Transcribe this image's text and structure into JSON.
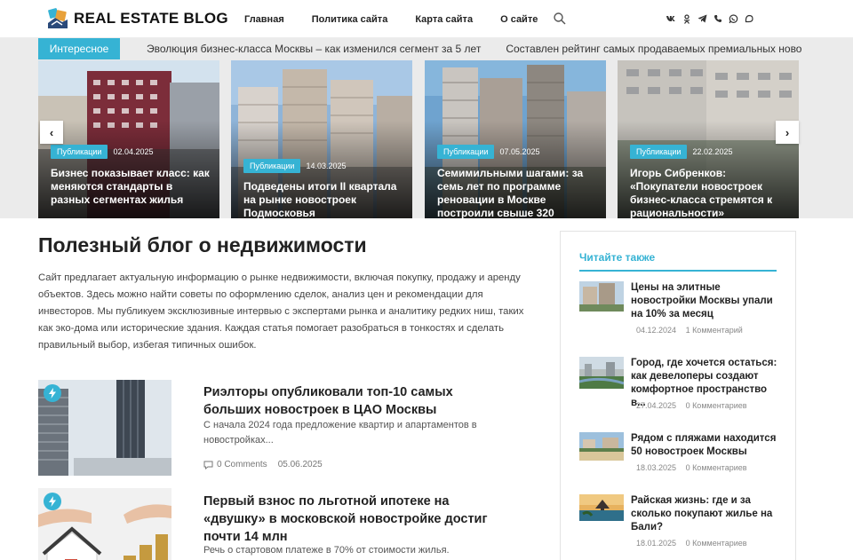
{
  "header": {
    "logo_text": "REAL ESTATE BLOG",
    "nav": [
      "Главная",
      "Политика сайта",
      "Карта сайта",
      "О сайте"
    ],
    "socials": [
      "vk-icon",
      "odnoklassniki-icon",
      "telegram-icon",
      "viber-icon",
      "whatsapp-icon",
      "max-icon"
    ]
  },
  "ticker": {
    "label": "Интересное",
    "items": [
      "Эволюция бизнес-класса Москвы – как изменился сегмент за 5 лет",
      "Составлен рейтинг самых продаваемых премиальных новостроек"
    ]
  },
  "slider": {
    "prev_label": "‹",
    "next_label": "›",
    "cards": [
      {
        "badge": "Публикации",
        "date": "02.04.2025",
        "title": "Бизнес показывает класс: как меняются стандарты в разных сегментах жилья"
      },
      {
        "badge": "Публикации",
        "date": "14.03.2025",
        "title": "Подведены итоги II квартала на рынке новостроек Подмосковья"
      },
      {
        "badge": "Публикации",
        "date": "07.05.2025",
        "title": "Семимильными шагами: за семь лет по программе реновации в Москве построили свыше 320"
      },
      {
        "badge": "Публикации",
        "date": "22.02.2025",
        "title": "Игорь Сибренков: «Покупатели новостроек бизнес-класса стремятся к рациональности»"
      }
    ]
  },
  "main": {
    "title": "Полезный блог о недвижимости",
    "intro": "Сайт предлагает актуальную информацию о рынке недвижимости, включая покупку, продажу и аренду объектов. Здесь можно найти советы по оформлению сделок, анализ цен и рекомендации для инвесторов. Мы публикуем эксклюзивные интервью с экспертами рынка и аналитику редких ниш, таких как эко-дома или исторические здания. Каждая статья помогает разобраться в тонкостях и сделать правильный выбор, избегая типичных ошибок.",
    "posts": [
      {
        "title": "Риэлторы опубликовали топ-10 самых больших новостроек в ЦАО Москвы",
        "excerpt": "С начала 2024 года предложение квартир и апартаментов в новостройках...",
        "comments": "0 Comments",
        "date": "05.06.2025"
      },
      {
        "title": "Первый взнос по льготной ипотеке на «двушку» в московской новостройке достиг почти 14 млн",
        "excerpt": "Речь о стартовом платеже в 70% от стоимости жилья."
      }
    ]
  },
  "sidebar": {
    "title": "Читайте также",
    "items": [
      {
        "title": "Цены на элитные новостройки Москвы упали на 10% за месяц",
        "date": "04.12.2024",
        "comments": "1 Комментарий"
      },
      {
        "title": "Город, где хочется остаться: как девелоперы создают комфортное пространство в...",
        "date": "27.04.2025",
        "comments": "0 Комментариев"
      },
      {
        "title": "Рядом с пляжами находится 50 новостроек Москвы",
        "date": "18.03.2025",
        "comments": "0 Комментариев"
      },
      {
        "title": "Райская жизнь: где и за сколько покупают жилье на Бали?",
        "date": "18.01.2025",
        "comments": "0 Комментариев"
      }
    ]
  },
  "colors": {
    "accent": "#36b3d4"
  }
}
